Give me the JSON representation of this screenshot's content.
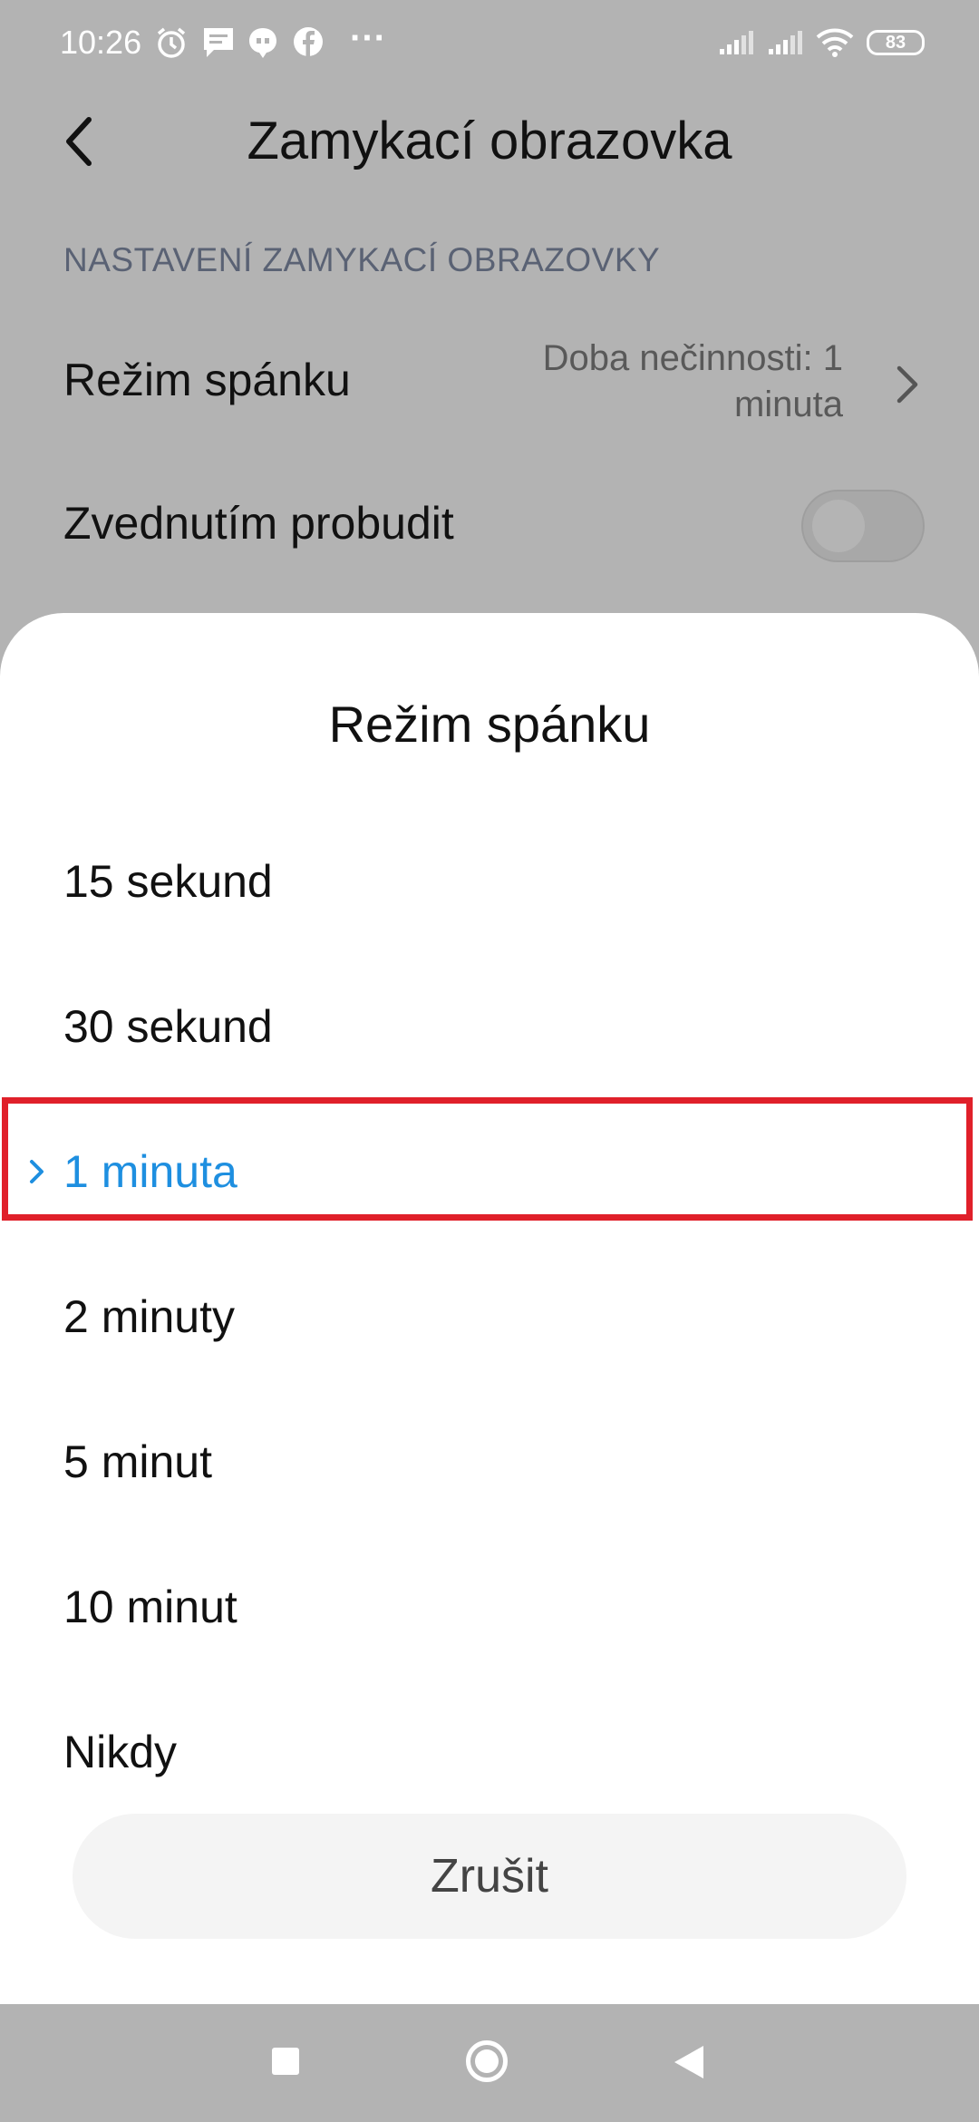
{
  "status_bar": {
    "time": "10:26",
    "notification_icons": [
      "alarm-icon",
      "message-icon",
      "chat-bubble-icon",
      "facebook-icon",
      "more-dots-icon"
    ],
    "more": "···",
    "battery": "83"
  },
  "header": {
    "title": "Zamykací obrazovka"
  },
  "settings": {
    "section_header": "NASTAVENÍ ZAMYKACÍ OBRAZOVKY",
    "sleep": {
      "label": "Režim spánku",
      "value_line1": "Doba nečinnosti: 1",
      "value_line2": "minuta"
    },
    "raise_to_wake": {
      "label": "Zvednutím probudit",
      "enabled": false
    }
  },
  "sheet": {
    "title": "Režim spánku",
    "options": [
      {
        "label": "15 sekund",
        "selected": false
      },
      {
        "label": "30 sekund",
        "selected": false
      },
      {
        "label": "1 minuta",
        "selected": true
      },
      {
        "label": "2 minuty",
        "selected": false
      },
      {
        "label": "5 minut",
        "selected": false
      },
      {
        "label": "10 minut",
        "selected": false
      },
      {
        "label": "Nikdy",
        "selected": false
      }
    ],
    "cancel_label": "Zrušit"
  },
  "colors": {
    "accent": "#1e8fe0",
    "highlight": "#e0202a",
    "overlay": "#b3b3b3"
  }
}
